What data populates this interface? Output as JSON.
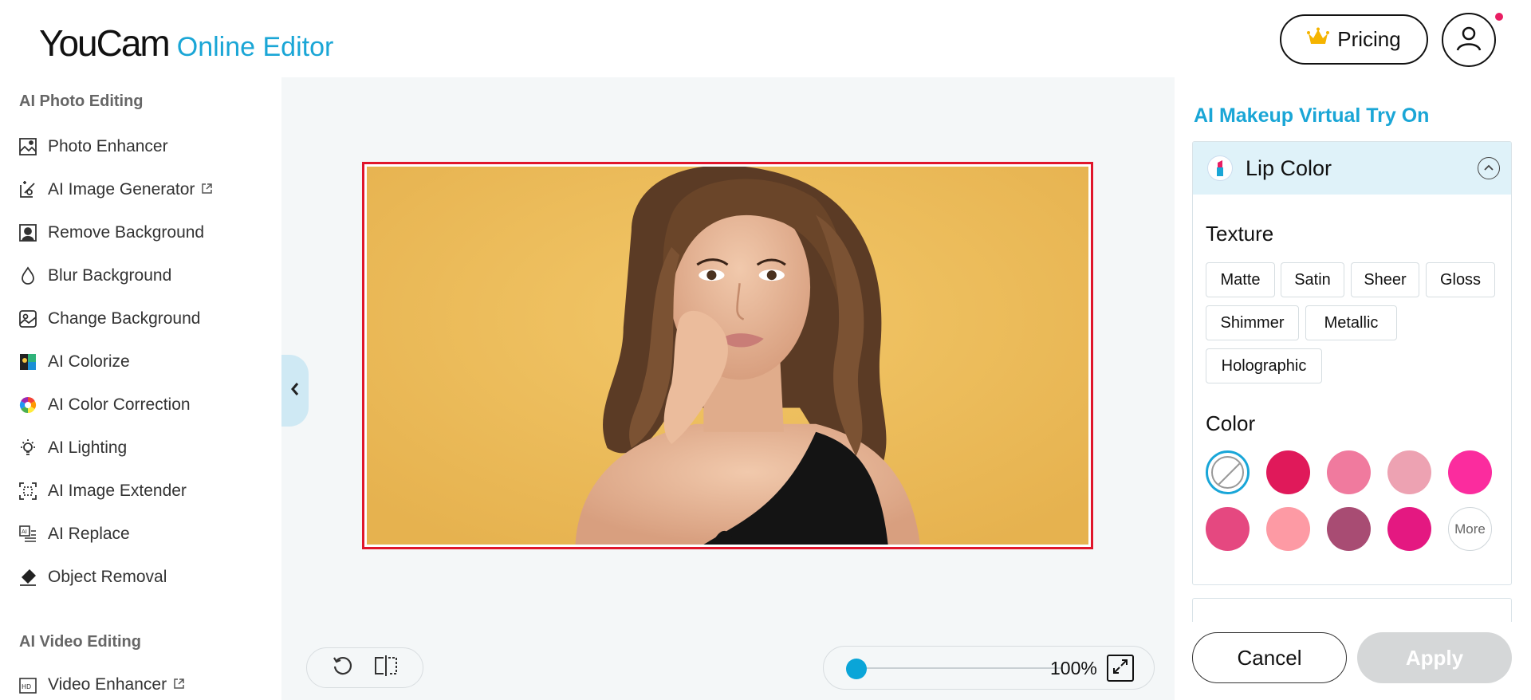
{
  "header": {
    "logo_main": "YouCam",
    "logo_sub": "Online Editor",
    "pricing_label": "Pricing"
  },
  "sidebar": {
    "photo_section_title": "AI Photo Editing",
    "photo_items": [
      {
        "label": "Photo Enhancer",
        "icon": "photo-enhancer-icon"
      },
      {
        "label": "AI Image Generator",
        "icon": "image-generator-icon",
        "external": true
      },
      {
        "label": "Remove Background",
        "icon": "remove-background-icon"
      },
      {
        "label": "Blur Background",
        "icon": "blur-drop-icon"
      },
      {
        "label": "Change Background",
        "icon": "change-background-icon"
      },
      {
        "label": "AI Colorize",
        "icon": "colorize-icon"
      },
      {
        "label": "AI Color Correction",
        "icon": "color-wheel-icon"
      },
      {
        "label": "AI Lighting",
        "icon": "lightbulb-icon"
      },
      {
        "label": "AI Image Extender",
        "icon": "image-extender-icon"
      },
      {
        "label": "AI Replace",
        "icon": "ai-replace-icon"
      },
      {
        "label": "Object Removal",
        "icon": "eraser-icon"
      }
    ],
    "video_section_title": "AI Video Editing",
    "video_items": [
      {
        "label": "Video Enhancer",
        "icon": "video-enhancer-icon",
        "external": true
      }
    ]
  },
  "canvas": {
    "zoom_value": "100%",
    "zoom_fraction": 0.0
  },
  "panel": {
    "title": "AI Makeup Virtual Try On",
    "lip": {
      "title": "Lip Color",
      "texture_title": "Texture",
      "textures": [
        "Matte",
        "Satin",
        "Sheer",
        "Gloss",
        "Shimmer",
        "Metallic",
        "Holographic"
      ],
      "color_title": "Color",
      "colors": [
        "none",
        "#e0195a",
        "#f07a9e",
        "#eda2b2",
        "#fb2c9e",
        "#e54880",
        "#fd9aa4",
        "#a84c73",
        "#e41881"
      ],
      "more_label": "More"
    },
    "cancel_label": "Cancel",
    "apply_label": "Apply"
  },
  "colors": {
    "accent": "#1aa6d6",
    "frame_border": "#e0162b",
    "canvas_bg": "#f4f7f8"
  }
}
